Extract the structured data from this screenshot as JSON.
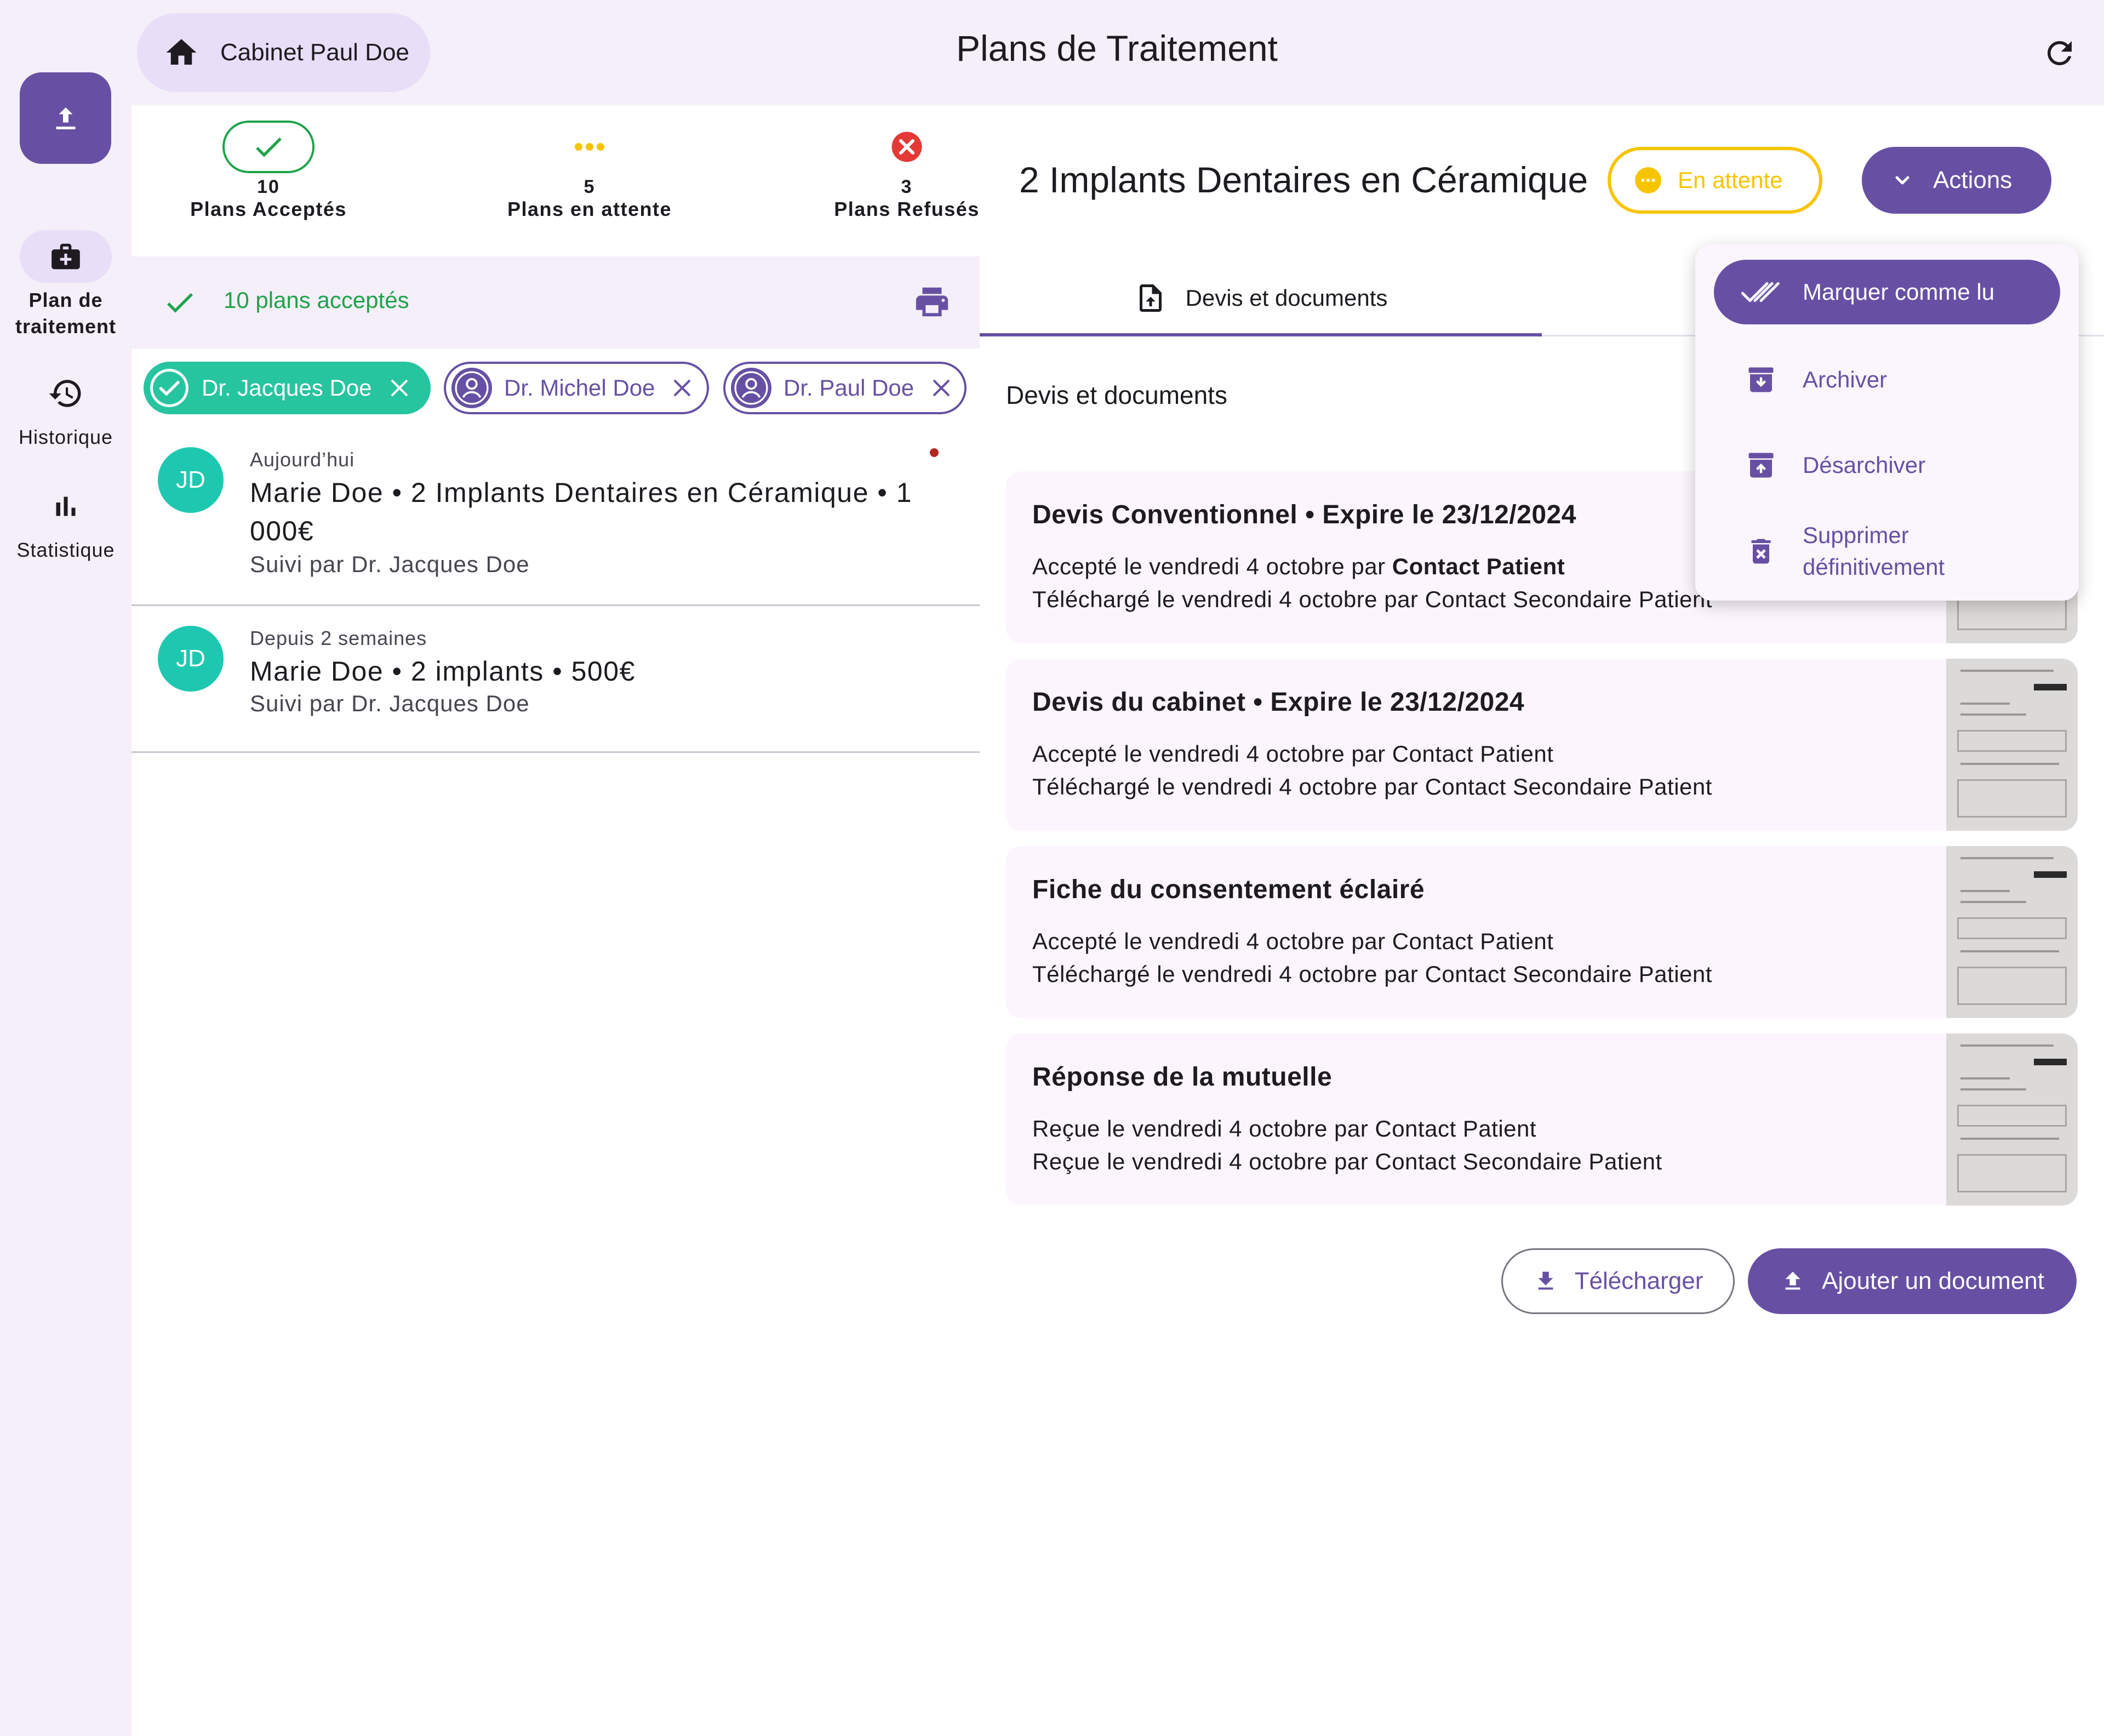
{
  "topbar": {
    "office_name": "Cabinet Paul Doe",
    "page_title": "Plans de Traitement"
  },
  "rail": {
    "items": [
      {
        "label": "Plan de traitement",
        "icon": "briefcase-plus-icon",
        "active": true
      },
      {
        "label": "Historique",
        "icon": "history-icon",
        "active": false
      },
      {
        "label": "Statistique",
        "icon": "bar-chart-icon",
        "active": false
      }
    ]
  },
  "stats": {
    "accepted": {
      "count": "10",
      "label": "Plans Acceptés"
    },
    "pending": {
      "count": "5",
      "label": "Plans en attente"
    },
    "refused": {
      "count": "3",
      "label": "Plans Refusés"
    }
  },
  "filter": {
    "text": "10 plans acceptés"
  },
  "chips": [
    {
      "label": "Dr. Jacques Doe",
      "selected": true
    },
    {
      "label": "Dr. Michel Doe",
      "selected": false
    },
    {
      "label": "Dr. Paul Doe",
      "selected": false
    }
  ],
  "plans": [
    {
      "initials": "JD",
      "when": "Aujourd’hui",
      "main": "Marie Doe • 2 Implants Dentaires en Céramique • 1 000€",
      "sub": "Suivi par Dr. Jacques Doe",
      "unread": true
    },
    {
      "initials": "JD",
      "when": "Depuis 2 semaines",
      "main": "Marie Doe • 2 implants • 500€",
      "sub": "Suivi par Dr. Jacques Doe",
      "unread": false
    }
  ],
  "detail": {
    "title": "2 Implants Dentaires en Céramique",
    "status": "En attente",
    "actions_label": "Actions",
    "tab_label": "Devis et documents",
    "section_title": "Devis et documents",
    "documents": [
      {
        "title": "Devis Conventionnel • Expire le 23/12/2024",
        "line1_prefix": "Accepté le vendredi 4 octobre par ",
        "line1_bold": "Contact Patient",
        "line2": "Téléchargé le vendredi 4 octobre par Contact Secondaire Patient"
      },
      {
        "title": "Devis du cabinet • Expire le 23/12/2024",
        "line1_prefix": "Accepté le vendredi 4 octobre par Contact Patient",
        "line1_bold": "",
        "line2": "Téléchargé le vendredi 4 octobre par Contact Secondaire Patient"
      },
      {
        "title": "Fiche du consentement éclairé",
        "line1_prefix": "Accepté le vendredi 4 octobre par Contact Patient",
        "line1_bold": "",
        "line2": "Téléchargé le vendredi 4 octobre par Contact Secondaire Patient"
      },
      {
        "title": "Réponse de la mutuelle",
        "line1_prefix": "Reçue le vendredi 4 octobre par Contact Patient",
        "line1_bold": "",
        "line2": "Reçue le vendredi 4 octobre par Contact Secondaire Patient"
      }
    ],
    "download_label": "Télécharger",
    "add_label": "Ajouter un document"
  },
  "menu": {
    "items": [
      {
        "label": "Marquer comme lu",
        "icon": "double-check-icon"
      },
      {
        "label": "Archiver",
        "icon": "archive-icon"
      },
      {
        "label": "Désarchiver",
        "icon": "unarchive-icon"
      },
      {
        "label_line1": "Supprimer",
        "label_line2": "définitivement",
        "icon": "delete-forever-icon"
      }
    ]
  },
  "colors": {
    "primary": "#6750a4",
    "accepted_green": "#1ea34a",
    "pending_yellow": "#f7c400",
    "refused_red": "#e53935",
    "avatar_teal": "#1ec8b0"
  }
}
